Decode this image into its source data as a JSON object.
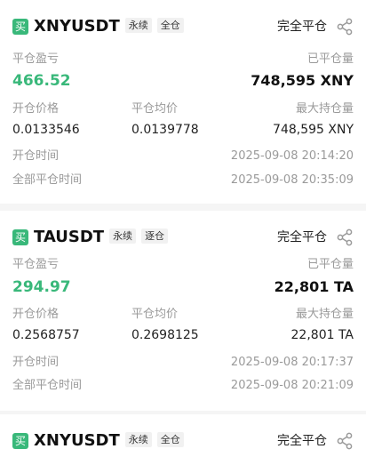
{
  "colors": {
    "accent_green": "#39b87a",
    "label_gray": "#9a9a9a"
  },
  "positions": [
    {
      "side": "买",
      "symbol": "XNYUSDT",
      "tag_contract": "永续",
      "tag_margin": "全仓",
      "close_all": "完全平仓",
      "share_icon": "share-icon",
      "pnl_label": "平仓盈亏",
      "pnl_value": "466.52",
      "closed_qty_label": "已平仓量",
      "closed_qty_value": "748,595 XNY",
      "open_price_label": "开仓价格",
      "open_price_value": "0.0133546",
      "avg_close_label": "平仓均价",
      "avg_close_value": "0.0139778",
      "max_hold_label": "最大持仓量",
      "max_hold_value": "748,595 XNY",
      "open_time_label": "开仓时间",
      "open_time_value": "2025-09-08 20:14:20",
      "close_time_label": "全部平仓时间",
      "close_time_value": "2025-09-08 20:35:09"
    },
    {
      "side": "买",
      "symbol": "TAUSDT",
      "tag_contract": "永续",
      "tag_margin": "逐仓",
      "close_all": "完全平仓",
      "share_icon": "share-icon",
      "pnl_label": "平仓盈亏",
      "pnl_value": "294.97",
      "closed_qty_label": "已平仓量",
      "closed_qty_value": "22,801 TA",
      "open_price_label": "开仓价格",
      "open_price_value": "0.2568757",
      "avg_close_label": "平仓均价",
      "avg_close_value": "0.2698125",
      "max_hold_label": "最大持仓量",
      "max_hold_value": "22,801 TA",
      "open_time_label": "开仓时间",
      "open_time_value": "2025-09-08 20:17:37",
      "close_time_label": "全部平仓时间",
      "close_time_value": "2025-09-08 20:21:09"
    },
    {
      "side": "买",
      "symbol": "XNYUSDT",
      "tag_contract": "永续",
      "tag_margin": "全仓",
      "close_all": "完全平仓",
      "share_icon": "share-icon"
    }
  ]
}
